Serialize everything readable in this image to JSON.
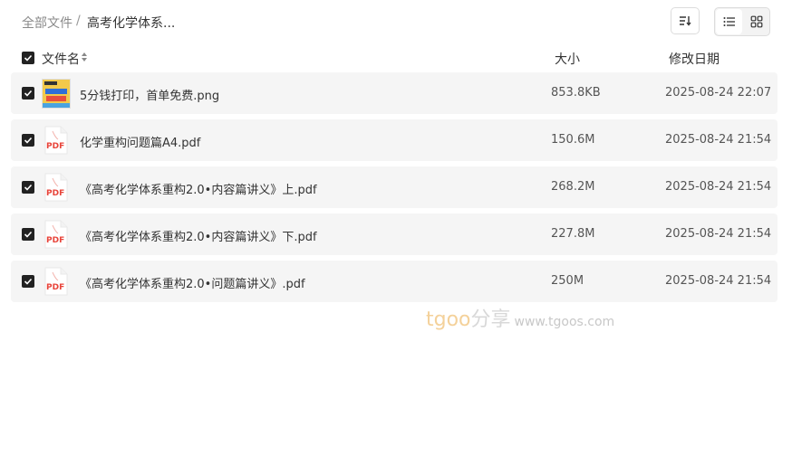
{
  "breadcrumb": {
    "root": "全部文件",
    "separator": "/",
    "current": "高考化学体系..."
  },
  "toolbar": {
    "sort_icon": "sort-icon",
    "list_view_icon": "list-view-icon",
    "grid_view_icon": "grid-view-icon"
  },
  "table": {
    "headers": {
      "name": "文件名",
      "size": "大小",
      "date": "修改日期"
    },
    "rows": [
      {
        "name": "5分钱打印，首单免费.png",
        "size": "853.8KB",
        "date": "2025-08-24 22:07",
        "type": "image",
        "checked": true
      },
      {
        "name": "化学重构问题篇A4.pdf",
        "size": "150.6M",
        "date": "2025-08-24 21:54",
        "type": "pdf",
        "checked": true
      },
      {
        "name": "《高考化学体系重构2.0•内容篇讲义》上.pdf",
        "size": "268.2M",
        "date": "2025-08-24 21:54",
        "type": "pdf",
        "checked": true
      },
      {
        "name": "《高考化学体系重构2.0•内容篇讲义》下.pdf",
        "size": "227.8M",
        "date": "2025-08-24 21:54",
        "type": "pdf",
        "checked": true
      },
      {
        "name": "《高考化学体系重构2.0•问题篇讲义》.pdf",
        "size": "250M",
        "date": "2025-08-24 21:54",
        "type": "pdf",
        "checked": true
      }
    ]
  },
  "pdf_label": "PDF",
  "watermark": {
    "brand": "tgoo",
    "cn": "分享",
    "url": "www.tgoos.com"
  },
  "colors": {
    "row_bg": "#f5f5f5",
    "checkbox": "#222222",
    "pdf_red": "#e8443a"
  }
}
